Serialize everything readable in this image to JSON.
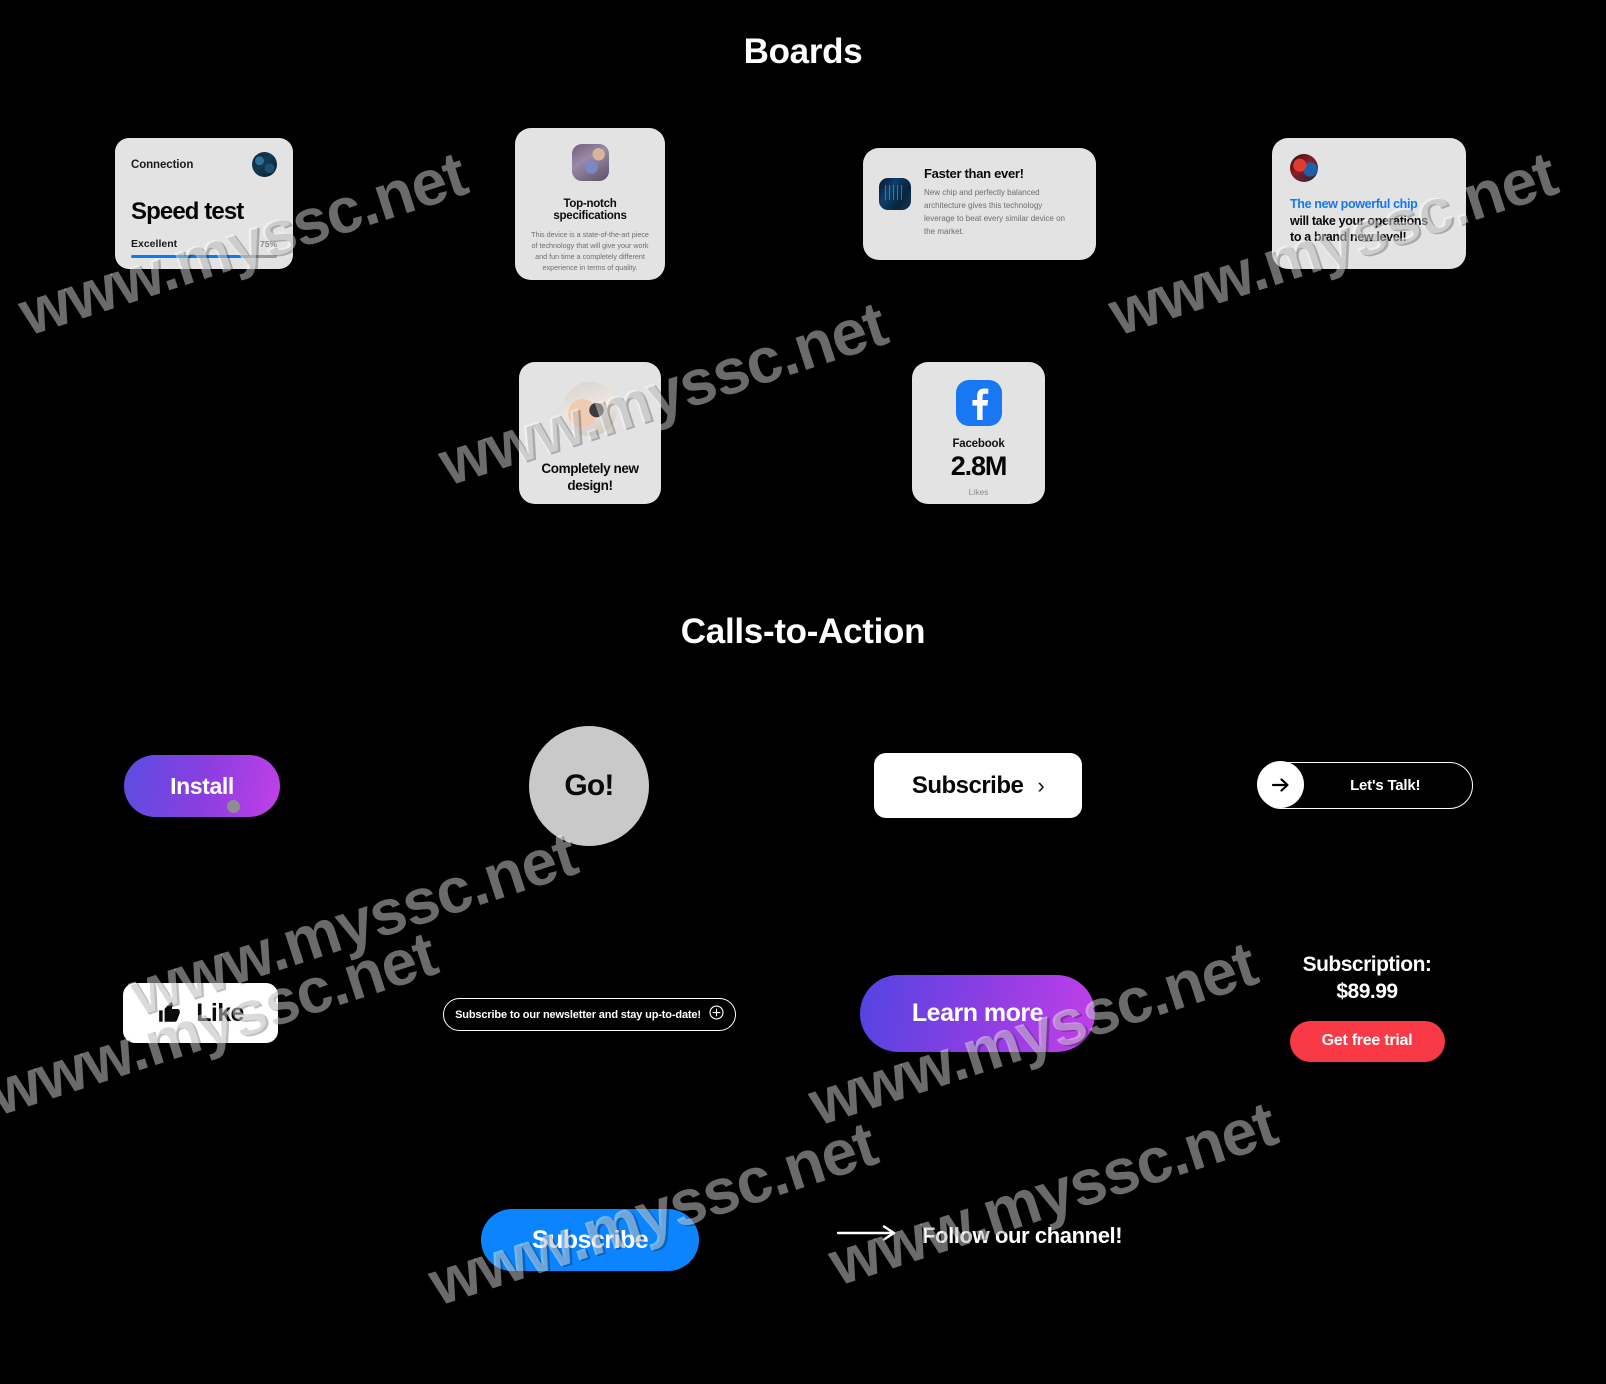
{
  "sections": {
    "boards_title": "Boards",
    "cta_title": "Calls-to-Action"
  },
  "boards": {
    "speed_test": {
      "label": "Connection",
      "title": "Speed test",
      "quality": "Excellent",
      "percent_label": "75%",
      "percent_value": 75,
      "bar_color": "#0a7cf0",
      "avatar": "network-avatar"
    },
    "specs": {
      "title": "Top-notch specifications",
      "body": "This device is a state-of-the-art piece of technology that will give your work and fun time a completely different experience in terms of quality.",
      "thumb": "device-thumbnail"
    },
    "faster": {
      "title": "Faster than ever!",
      "body": "New chip and perfectly balanced architecture gives this technology leverage to beat every similar device on the market.",
      "thumb": "chip-thumbnail"
    },
    "chip": {
      "accent_line": "The new powerful chip",
      "rest_line_1": "will take your operations",
      "rest_line_2": "to a brand new level!",
      "accent_color": "#1478f0",
      "avatar": "chip-avatar"
    },
    "design": {
      "line1": "Completely new",
      "line2": "design!",
      "thumb": "watch-thumbnail"
    },
    "facebook": {
      "name": "Facebook",
      "count": "2.8M",
      "sub": "Likes",
      "brand_color": "#1877f2",
      "icon": "facebook-icon"
    }
  },
  "cta": {
    "install": {
      "label": "Install",
      "gradient_from": "#5b4de0",
      "gradient_to": "#c040e8"
    },
    "go": {
      "label": "Go!",
      "bg": "#c9c9c9"
    },
    "subscribe_white": {
      "label": "Subscribe",
      "chevron": "›"
    },
    "lets_talk": {
      "label": "Let's Talk!",
      "icon": "arrow-right-icon"
    },
    "like": {
      "label": "Like",
      "icon": "thumbs-up-icon"
    },
    "newsletter": {
      "label": "Subscribe to our newsletter and stay up-to-date!",
      "icon": "plus-circle-icon"
    },
    "learn_more": {
      "label": "Learn more",
      "gradient_from": "#5344e2",
      "gradient_to": "#c13fe8"
    },
    "subscription": {
      "heading": "Subscription:",
      "price": "$89.99",
      "button_label": "Get free trial",
      "button_color": "#f93a46"
    },
    "subscribe_blue": {
      "label": "Subscribe",
      "bg": "#0b84fe"
    },
    "follow": {
      "label": "Follow our channel!",
      "icon": "long-arrow-right-icon"
    }
  },
  "watermark": {
    "text": "www.myssc.net"
  }
}
